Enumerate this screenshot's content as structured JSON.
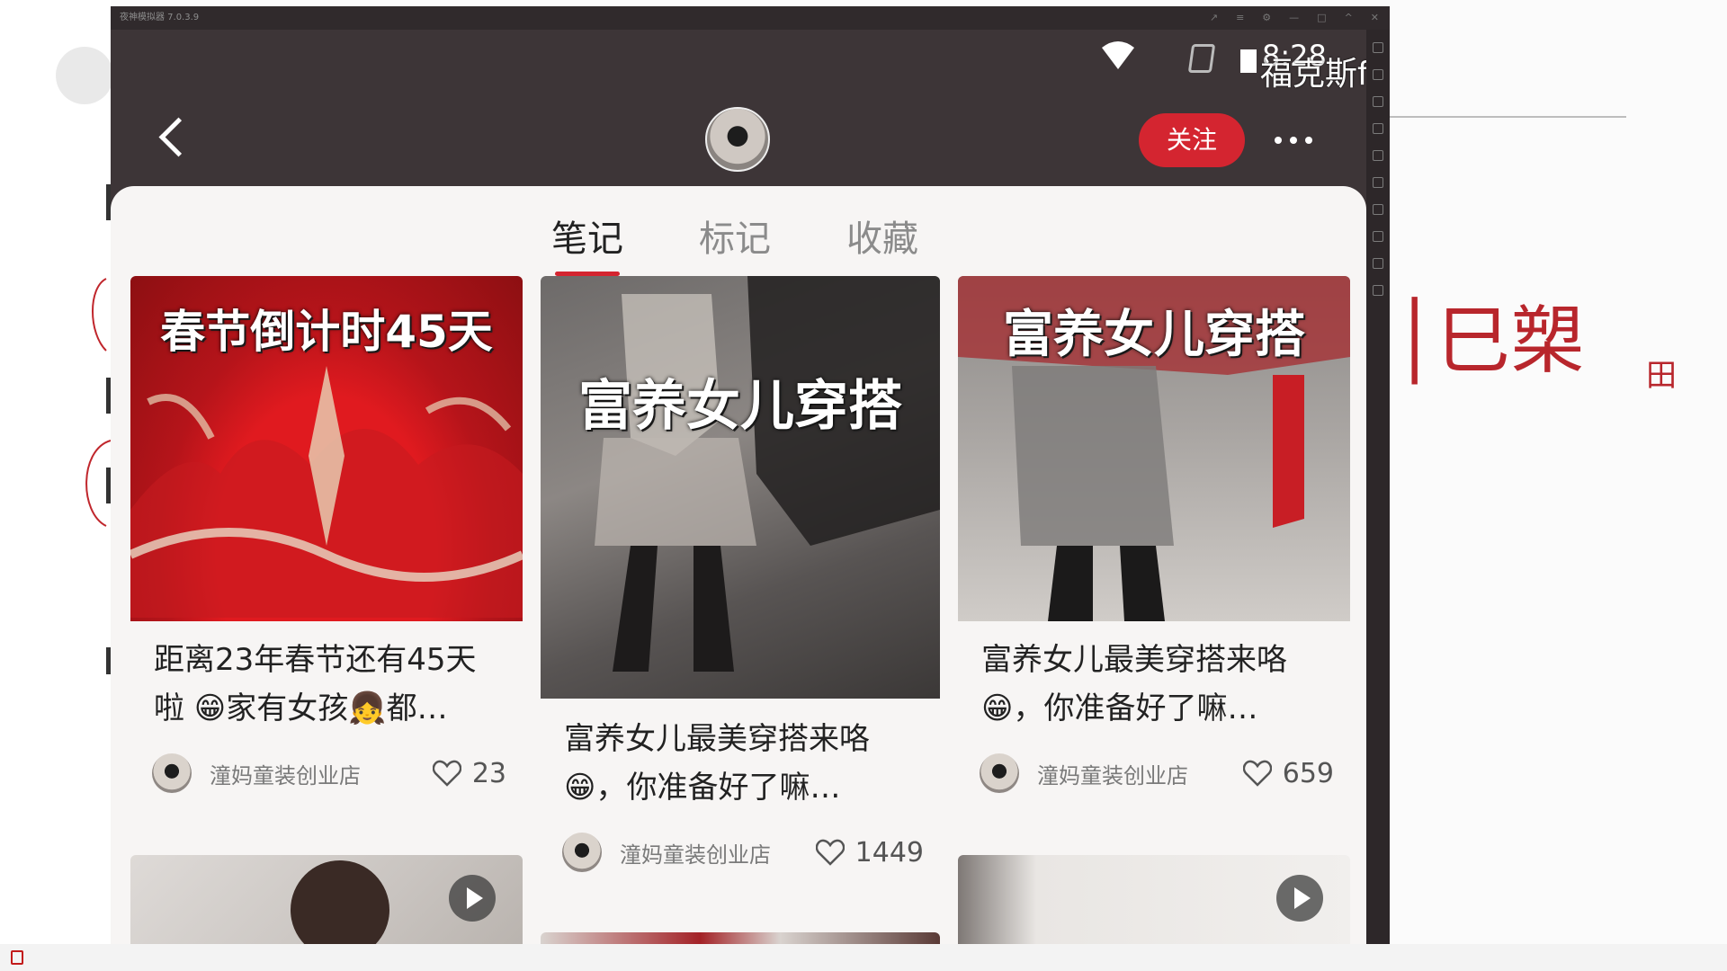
{
  "emulator": {
    "title": "夜神模拟器 7.0.3.9",
    "controls": [
      "↗",
      "≡",
      "⚙",
      "—",
      "□",
      "^",
      "✕"
    ]
  },
  "status_bar": {
    "time": "8:28",
    "wifi_icon": "wifi-icon",
    "sim_icon": "no-sim-icon",
    "battery_icon": "battery-icon"
  },
  "overlay_text": "福克斯fa",
  "header": {
    "back_icon": "chevron-left-icon",
    "follow_label": "关注",
    "more_icon": "more-dots-icon"
  },
  "tabs": [
    {
      "label": "笔记",
      "active": true
    },
    {
      "label": "标记",
      "active": false
    },
    {
      "label": "收藏",
      "active": false
    }
  ],
  "notes": [
    {
      "cover_text": "春节倒计时45天",
      "title": "距离23年春节还有45天啦 😁家有女孩👧都…",
      "author": "潼妈童装创业店",
      "likes": "23"
    },
    {
      "cover_text": "富养女儿穿搭",
      "title": "富养女儿最美穿搭来咯 😁，你准备好了嘛…",
      "author": "潼妈童装创业店",
      "likes": "1449"
    },
    {
      "cover_text": "富养女儿穿搭",
      "title": "富养女儿最美穿搭来咯 😁，你准备好了嘛…",
      "author": "潼妈童装创业店",
      "likes": "659"
    }
  ],
  "annotations": {
    "handwriting": "│巳槊",
    "small_mark": "田"
  },
  "colors": {
    "accent": "#d42530",
    "screen_bg": "#3d3537",
    "panel_bg": "#f7f5f4"
  }
}
